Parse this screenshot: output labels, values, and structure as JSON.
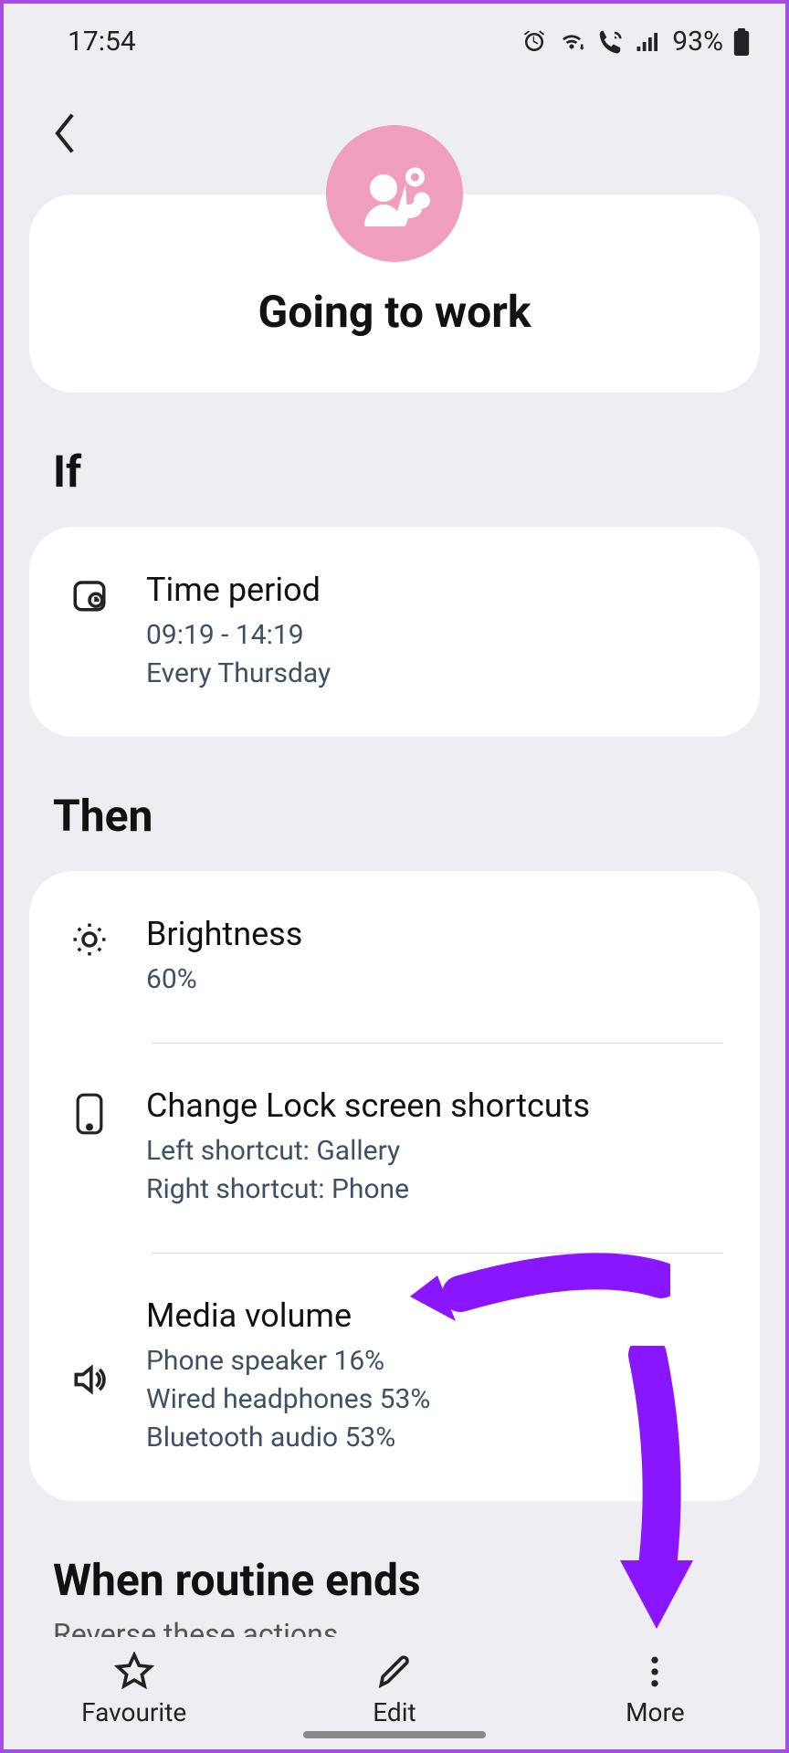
{
  "status": {
    "time": "17:54",
    "battery": "93%"
  },
  "routine": {
    "title": "Going to work"
  },
  "if": {
    "label": "If",
    "item": {
      "title": "Time period",
      "time_range": "09:19 - 14:19",
      "repeat": "Every Thursday"
    }
  },
  "then": {
    "label": "Then",
    "items": [
      {
        "title": "Brightness",
        "sub1": "60%"
      },
      {
        "title": "Change Lock screen shortcuts",
        "sub1": "Left shortcut: Gallery",
        "sub2": "Right shortcut: Phone"
      },
      {
        "title": "Media volume",
        "sub1": "Phone speaker 16%",
        "sub2": "Wired headphones 53%",
        "sub3": "Bluetooth audio 53%"
      }
    ]
  },
  "ends": {
    "label": "When routine ends",
    "sub": "Reverse these actions."
  },
  "bottom": {
    "favourite": "Favourite",
    "edit": "Edit",
    "more": "More"
  }
}
